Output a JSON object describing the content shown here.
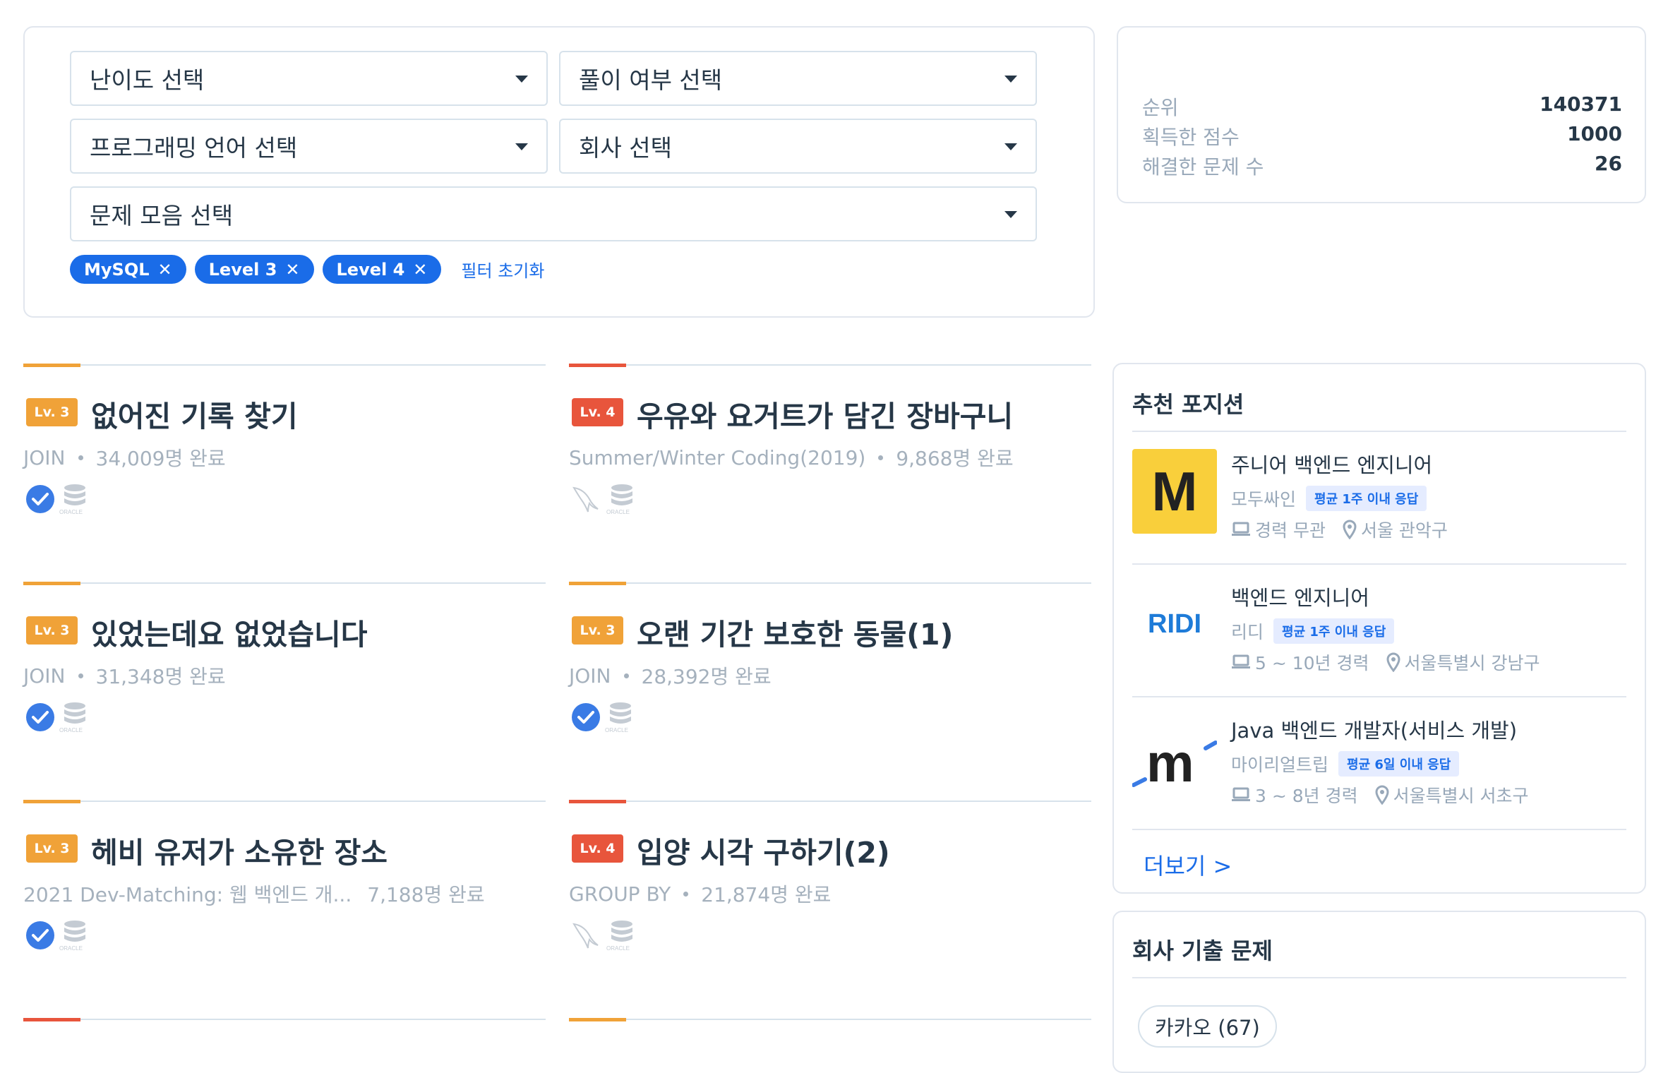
{
  "filters": {
    "difficulty": "난이도 선택",
    "solved_status": "풀이 여부 선택",
    "language": "프로그래밍 언어 선택",
    "company": "회사 선택",
    "collection": "문제 모음 선택",
    "chips": [
      "MySQL",
      "Level 3",
      "Level 4"
    ],
    "reset": "필터 초기화"
  },
  "stats": {
    "rank_label": "순위",
    "rank_value": "140371",
    "score_label": "획득한 점수",
    "score_value": "1000",
    "solved_label": "해결한 문제 수",
    "solved_value": "26"
  },
  "problems": [
    {
      "level": "Lv. 3",
      "title": "없어진 기록 찾기",
      "category": "JOIN",
      "completed": "34,009명 완료",
      "solved": true
    },
    {
      "level": "Lv. 4",
      "title": "우유와 요거트가 담긴 장바구니",
      "category": "Summer/Winter Coding(2019)",
      "completed": "9,868명 완료",
      "solved": false
    },
    {
      "level": "Lv. 3",
      "title": "있었는데요 없었습니다",
      "category": "JOIN",
      "completed": "31,348명 완료",
      "solved": true
    },
    {
      "level": "Lv. 3",
      "title": "오랜 기간 보호한 동물(1)",
      "category": "JOIN",
      "completed": "28,392명 완료",
      "solved": true
    },
    {
      "level": "Lv. 3",
      "title": "헤비 유저가 소유한 장소",
      "category": "2021 Dev-Matching: 웹 백엔드 개...",
      "completed": "7,188명 완료",
      "solved": true
    },
    {
      "level": "Lv. 4",
      "title": "입양 시각 구하기(2)",
      "category": "GROUP BY",
      "completed": "21,874명 완료",
      "solved": false
    }
  ],
  "db_icon_label": "ORACLE",
  "positions": {
    "title": "추천 포지션",
    "jobs": [
      {
        "title": "주니어 백엔드 엔지니어",
        "company": "모두싸인",
        "response": "평균 1주 이내 응답",
        "experience": "경력 무관",
        "location": "서울 관악구",
        "logo_text": "M"
      },
      {
        "title": "백엔드 엔지니어",
        "company": "리디",
        "response": "평균 1주 이내 응답",
        "experience": "5 ~ 10년 경력",
        "location": "서울특별시 강남구",
        "logo_text": "RIDI"
      },
      {
        "title": "Java 백엔드 개발자(서비스 개발)",
        "company": "마이리얼트립",
        "response": "평균 6일 이내 응답",
        "experience": "3 ~ 8년 경력",
        "location": "서울특별시 서초구",
        "logo_text": "m"
      }
    ],
    "more": "더보기 >"
  },
  "company_problems": {
    "title": "회사 기출 문제",
    "chip": "카카오 (67)"
  },
  "colors": {
    "primary": "#1a6ce8",
    "level3": "#f0a238",
    "level4": "#e8553c",
    "text": "#263747",
    "muted": "#98a8b9"
  }
}
